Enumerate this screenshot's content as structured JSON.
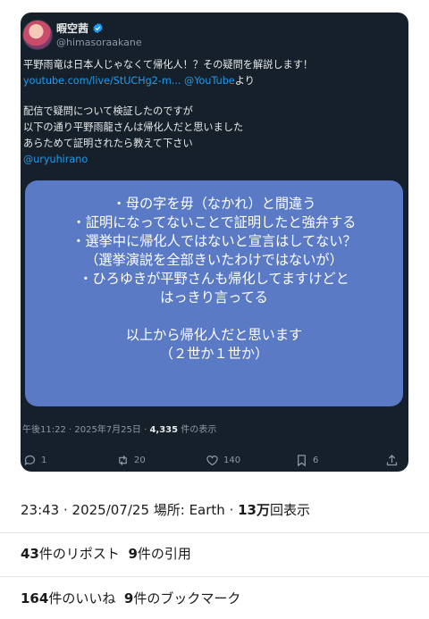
{
  "tweet": {
    "display_name": "暇空茜",
    "handle": "@himasoraakane",
    "body_lines": [
      {
        "text": "平野雨竜は日本人じゃなくて帰化人！？その疑問を解説します！"
      },
      {
        "link": "youtube.com/live/StUCHg2-m...",
        "mention": "@YouTube",
        "suffix": "より"
      },
      {
        "text": "配信で疑問について検証したのですが"
      },
      {
        "text": "以下の通り平野雨龍さんは帰化人だと思いました"
      },
      {
        "text": "あらためて証明されたら教えて下さい"
      },
      {
        "mention": "@uryuhirano"
      }
    ],
    "card_lines": [
      "・母の字を毋（なかれ）と間違う",
      "・証明になってないことで証明したと強弁する",
      "・選挙中に帰化人ではないと宣言はしてない？",
      "（選挙演説を全部きいたわけではないが）",
      "・ひろゆきが平野さんも帰化してますけどと",
      "はっきり言ってる",
      "",
      "以上から帰化人だと思います",
      "（２世か１世か）"
    ],
    "meta": {
      "time": "午後11:22 · 2025年7月25日 · ",
      "views": "4,335",
      "views_label": " 件の表示"
    },
    "actions": {
      "replies": "1",
      "retweets": "20",
      "likes": "140",
      "bookmarks": "6"
    }
  },
  "post_stats": {
    "line1": {
      "time": "23:43 · 2025/07/25 場所: Earth · ",
      "views": "13万",
      "views_label": "回表示"
    },
    "line2": {
      "reposts": "43",
      "reposts_label": "件のリポスト",
      "quotes": "9",
      "quotes_label": "件の引用"
    },
    "line3": {
      "likes": "164",
      "likes_label": "件のいいね",
      "bookmarks": "9",
      "bookmarks_label": "件のブックマーク"
    }
  },
  "colors": {
    "embed_bg": "#15202b",
    "link": "#1d9bf0",
    "card_bg": "#5a7ac6",
    "verified": "#1d9bf0"
  },
  "icons": [
    "verified-badge-icon",
    "reply-icon",
    "retweet-icon",
    "like-icon",
    "bookmark-icon",
    "share-icon"
  ]
}
